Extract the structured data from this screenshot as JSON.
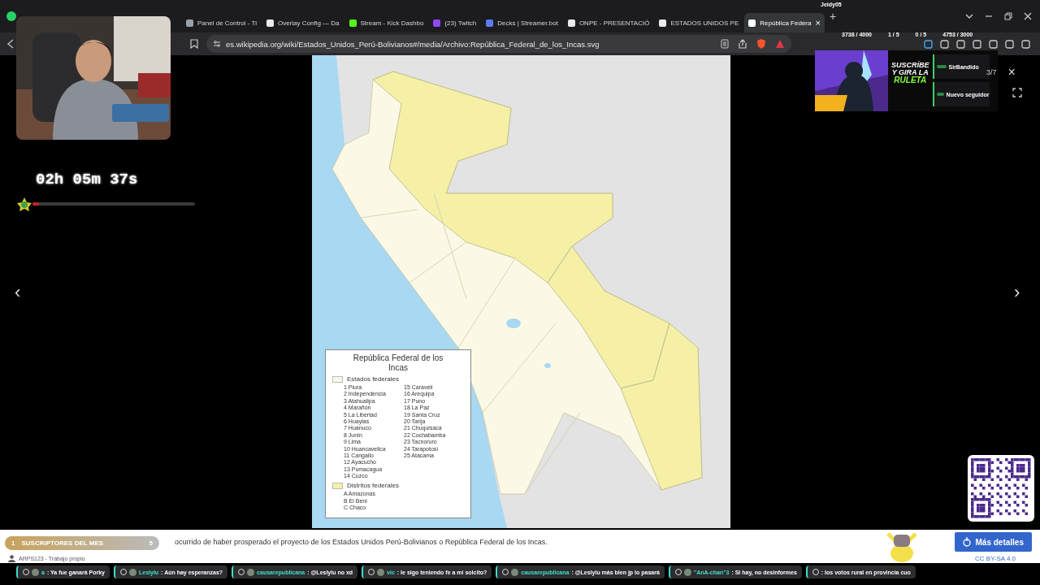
{
  "stream_overlay": {
    "user": "Jeidy05",
    "counters": [
      "3738 / 4000",
      "1 / 5",
      "0 / 5",
      "4753 / 3000"
    ]
  },
  "browser": {
    "tabs": [
      {
        "label": "Panel de Control - Ti",
        "selected": false,
        "color": "#9aa0a6"
      },
      {
        "label": "Overlay Config — Da",
        "selected": false,
        "color": "#e8eaed"
      },
      {
        "label": "Stream - Kick Dashbo",
        "selected": false,
        "color": "#53fc18"
      },
      {
        "label": "(23) Twitch",
        "selected": false,
        "color": "#9146ff"
      },
      {
        "label": "Decks | Streamer.bot",
        "selected": false,
        "color": "#5b7cfa"
      },
      {
        "label": "ONPE - PRESENTACIÓ",
        "selected": false,
        "color": "#e8eaed"
      },
      {
        "label": "ESTADOS UNIDOS PE",
        "selected": false,
        "color": "#e8eaed"
      },
      {
        "label": "República Federa",
        "selected": true,
        "color": "#ffffff"
      }
    ],
    "tab_close": "×",
    "new_tab": "+",
    "url": "es.wikipedia.org/wiki/Estados_Unidos_Perú-Bolivianos#/media/Archivo:República_Federal_de_los_Incas.svg"
  },
  "timer": {
    "time": "02h 05m 37s",
    "level": 0.04
  },
  "viewer": {
    "counter": "3/7",
    "close": "×",
    "prev": "‹",
    "next": "›",
    "map": {
      "title": "República Federal de los Incas",
      "legend": [
        {
          "label": "Estados federales",
          "color": "#fbf9e6",
          "entries": [
            "1 Piura",
            "2 Independencia",
            "3 Atahualipa",
            "4 Marañón",
            "5 La Libertad",
            "6 Huaylas",
            "7 Huánuco",
            "8 Junín",
            "9 Lima",
            "10 Huancavelica",
            "11 Cangallo",
            "12 Ayacucho",
            "13 Pumacagua",
            "14 Cuzco",
            "15 Caravelí",
            "16 Arequipa",
            "17 Puno",
            "18 La Paz",
            "19 Santa Cruz",
            "20 Tarija",
            "21 Chuquisaca",
            "22 Cochabamba",
            "23 Tacnoruro",
            "24 Tarapotosí",
            "25 Atacama"
          ]
        },
        {
          "label": "Distritos federales",
          "color": "#f6f0a6",
          "entries": [
            "A Amazonas",
            "B El Beni",
            "C Chaco"
          ]
        }
      ]
    }
  },
  "caption": {
    "text": "ocurrido de haber prosperado el proyecto de los Estados Unidos Perú-Bolivianos o República Federal de los Incas.",
    "button": "Más detalles",
    "author": "ARPS123 - Trabajo propio",
    "license": "CC BY-SA 4.0"
  },
  "promo": {
    "lines": [
      "SUSCRÍBE",
      "Y GIRA LA",
      "RULETA"
    ]
  },
  "alerts": [
    {
      "name": "SirBandido"
    },
    {
      "name": "Nuevo seguidor"
    }
  ],
  "subs_badge": {
    "rank": "1",
    "label": "SUSCRIPTORES DEL MES",
    "count": "5"
  },
  "chat": [
    {
      "user": "a",
      "message": ": Ya fue ganará Porky"
    },
    {
      "user": "Leslylu",
      "message": ": Aún hay esperanzas?"
    },
    {
      "user": "causarepublicana",
      "message": ": @Leslylu no xd"
    },
    {
      "user": "vic",
      "message": ": le sigo teniendo fe a mi solcito?"
    },
    {
      "user": "causarepublicana",
      "message": ": @Leslylu más bien jp lo pasará"
    },
    {
      "user": "\"AnA-chan\"3",
      "message": ": Si hay, no desinformes"
    },
    {
      "message": ": los votos rural en provincia cuo"
    }
  ]
}
